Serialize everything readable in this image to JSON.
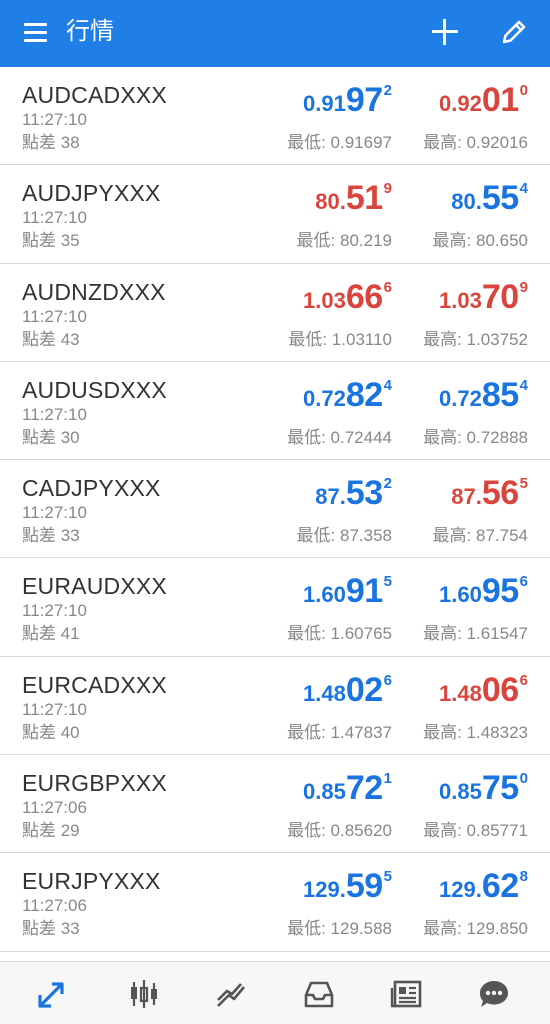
{
  "header": {
    "title": "行情"
  },
  "colors": {
    "up": "#1a74e0",
    "down": "#d9453d",
    "appbar": "#1f7fe6"
  },
  "quotes": [
    {
      "symbol": "AUDCADXXX",
      "time": "11:27:10",
      "spread": "點差 38",
      "bid": {
        "p1": "0.91",
        "p2": "97",
        "p3": "2",
        "dir": "up"
      },
      "ask": {
        "p1": "0.92",
        "p2": "01",
        "p3": "0",
        "dir": "down"
      },
      "low": "最低: 0.91697",
      "high": "最高: 0.92016"
    },
    {
      "symbol": "AUDJPYXXX",
      "time": "11:27:10",
      "spread": "點差 35",
      "bid": {
        "p1": "80.",
        "p2": "51",
        "p3": "9",
        "dir": "down"
      },
      "ask": {
        "p1": "80.",
        "p2": "55",
        "p3": "4",
        "dir": "up"
      },
      "low": "最低: 80.219",
      "high": "最高: 80.650"
    },
    {
      "symbol": "AUDNZDXXX",
      "time": "11:27:10",
      "spread": "點差 43",
      "bid": {
        "p1": "1.03",
        "p2": "66",
        "p3": "6",
        "dir": "down"
      },
      "ask": {
        "p1": "1.03",
        "p2": "70",
        "p3": "9",
        "dir": "down"
      },
      "low": "最低: 1.03110",
      "high": "最高: 1.03752"
    },
    {
      "symbol": "AUDUSDXXX",
      "time": "11:27:10",
      "spread": "點差 30",
      "bid": {
        "p1": "0.72",
        "p2": "82",
        "p3": "4",
        "dir": "up"
      },
      "ask": {
        "p1": "0.72",
        "p2": "85",
        "p3": "4",
        "dir": "up"
      },
      "low": "最低: 0.72444",
      "high": "最高: 0.72888"
    },
    {
      "symbol": "CADJPYXXX",
      "time": "11:27:10",
      "spread": "點差 33",
      "bid": {
        "p1": "87.",
        "p2": "53",
        "p3": "2",
        "dir": "up"
      },
      "ask": {
        "p1": "87.",
        "p2": "56",
        "p3": "5",
        "dir": "down"
      },
      "low": "最低: 87.358",
      "high": "最高: 87.754"
    },
    {
      "symbol": "EURAUDXXX",
      "time": "11:27:10",
      "spread": "點差 41",
      "bid": {
        "p1": "1.60",
        "p2": "91",
        "p3": "5",
        "dir": "up"
      },
      "ask": {
        "p1": "1.60",
        "p2": "95",
        "p3": "6",
        "dir": "up"
      },
      "low": "最低: 1.60765",
      "high": "最高: 1.61547"
    },
    {
      "symbol": "EURCADXXX",
      "time": "11:27:10",
      "spread": "點差 40",
      "bid": {
        "p1": "1.48",
        "p2": "02",
        "p3": "6",
        "dir": "up"
      },
      "ask": {
        "p1": "1.48",
        "p2": "06",
        "p3": "6",
        "dir": "down"
      },
      "low": "最低: 1.47837",
      "high": "最高: 1.48323"
    },
    {
      "symbol": "EURGBPXXX",
      "time": "11:27:06",
      "spread": "點差 29",
      "bid": {
        "p1": "0.85",
        "p2": "72",
        "p3": "1",
        "dir": "up"
      },
      "ask": {
        "p1": "0.85",
        "p2": "75",
        "p3": "0",
        "dir": "up"
      },
      "low": "最低: 0.85620",
      "high": "最高: 0.85771"
    },
    {
      "symbol": "EURJPYXXX",
      "time": "11:27:06",
      "spread": "點差 33",
      "bid": {
        "p1": "129.",
        "p2": "59",
        "p3": "5",
        "dir": "up"
      },
      "ask": {
        "p1": "129.",
        "p2": "62",
        "p3": "8",
        "dir": "up"
      },
      "low": "最低: 129.588",
      "high": "最高: 129.850"
    }
  ],
  "tabs": [
    {
      "icon": "quotes-arrows-icon",
      "active": true
    },
    {
      "icon": "candlestick-chart-icon",
      "active": false
    },
    {
      "icon": "trade-trend-icon",
      "active": false
    },
    {
      "icon": "history-inbox-icon",
      "active": false
    },
    {
      "icon": "news-icon",
      "active": false
    },
    {
      "icon": "chat-icon",
      "active": false
    }
  ]
}
